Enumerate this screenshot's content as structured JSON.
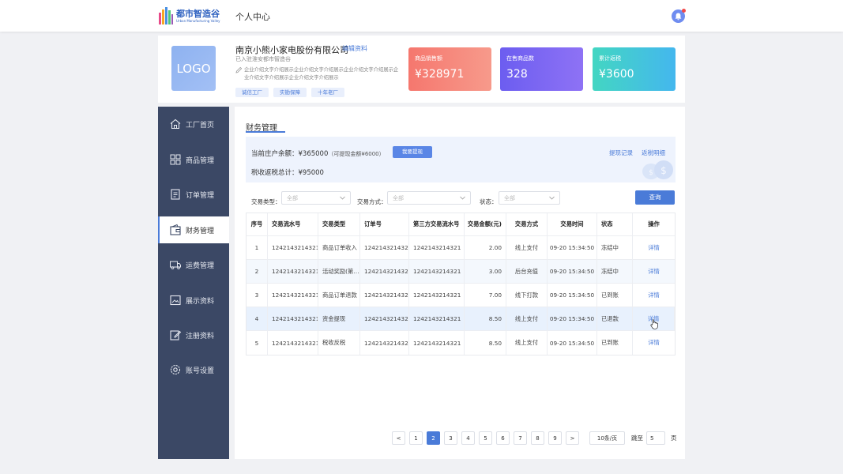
{
  "header": {
    "logo_cn": "都市智造谷",
    "logo_en": "Urban Manufacturing Valley",
    "nav_title": "个人中心"
  },
  "company": {
    "logo_text": "LOGO",
    "name": "南京小熊小家电股份有限公司",
    "edit_label": "编辑资料",
    "subtitle": "已入驻淮安都市智造谷",
    "description": "企业介绍文字介绍展示企业介绍文字介绍展示企业介绍文字介绍展示企业介绍文字介绍展示企业介绍文字介绍展示",
    "tags": [
      "诚信工厂",
      "实勘保障",
      "十年老厂"
    ]
  },
  "stats": [
    {
      "label": "商品销售额",
      "value": "¥328971"
    },
    {
      "label": "在售商品数",
      "value": "328"
    },
    {
      "label": "累计返税",
      "value": "¥3600"
    }
  ],
  "sidebar": {
    "items": [
      {
        "label": "工厂首页",
        "icon": "home-icon"
      },
      {
        "label": "商品管理",
        "icon": "grid-icon"
      },
      {
        "label": "订单管理",
        "icon": "document-icon"
      },
      {
        "label": "财务管理",
        "icon": "wallet-icon",
        "active": true
      },
      {
        "label": "运费管理",
        "icon": "truck-icon"
      },
      {
        "label": "展示资料",
        "icon": "image-icon"
      },
      {
        "label": "注册资料",
        "icon": "edit-icon"
      },
      {
        "label": "账号设置",
        "icon": "gear-icon"
      }
    ]
  },
  "finance": {
    "title": "财务管理",
    "balance_label": "当前庄户余额：¥365000",
    "balance_available": "（可提现金额¥6000）",
    "withdraw_button": "我要提现",
    "tax_total": "税收返税总计：¥95000",
    "link_withdraw_records": "提现记录",
    "link_tax_details": "返税明细"
  },
  "filters": {
    "type_label": "交易类型：",
    "type_value": "全部",
    "method_label": "交易方式：",
    "method_value": "全部",
    "status_label": "状态：",
    "status_value": "全部",
    "query_button": "查询"
  },
  "table": {
    "columns": [
      "序号",
      "交易流水号",
      "交易类型",
      "订单号",
      "第三方交易流水号",
      "交易金额(元)",
      "交易方式",
      "交易时间",
      "状态",
      "操作"
    ],
    "rows": [
      {
        "no": "1",
        "serial": "1242143214321",
        "type": "商品订单收入",
        "order": "1242143214321",
        "third": "1242143214321",
        "amount": "2.00",
        "method": "线上支付",
        "time": "09-20 15:34:50",
        "status": "冻结中",
        "action": "详情"
      },
      {
        "no": "2",
        "serial": "1242143214321",
        "type": "活动奖励(第…",
        "order": "1242143214321",
        "third": "1242143214321",
        "amount": "3.00",
        "method": "后台充值",
        "time": "09-20 15:34:50",
        "status": "冻结中",
        "action": "详情"
      },
      {
        "no": "3",
        "serial": "1242143214321",
        "type": "商品订单退款",
        "order": "1242143214321",
        "third": "1242143214321",
        "amount": "7.00",
        "method": "线下打款",
        "time": "09-20 15:34:50",
        "status": "已到账",
        "action": "详情"
      },
      {
        "no": "4",
        "serial": "1242143214321",
        "type": "资金提现",
        "order": "1242143214321",
        "third": "1242143214321",
        "amount": "8.50",
        "method": "线上支付",
        "time": "09-20 15:34:50",
        "status": "已退款",
        "action": "详情"
      },
      {
        "no": "5",
        "serial": "1242143214321",
        "type": "税收反税",
        "order": "1242143214321",
        "third": "1242143214321",
        "amount": "8.50",
        "method": "线上支付",
        "time": "09-20 15:34:50",
        "status": "已到账",
        "action": "详情"
      }
    ]
  },
  "pagination": {
    "prev": "<",
    "pages": [
      "1",
      "2",
      "3",
      "4",
      "5",
      "6",
      "7",
      "8",
      "9"
    ],
    "current": "2",
    "next": ">",
    "page_size": "10条/页",
    "jump_label": "跳至",
    "jump_value": "5",
    "page_suffix": "页"
  },
  "colors": {
    "accent": "#4a7bd8",
    "sidebar_bg": "#3b4865",
    "stat_red": "#f5776e",
    "stat_purple": "#6c5df0",
    "stat_teal": "#43d6c2"
  }
}
